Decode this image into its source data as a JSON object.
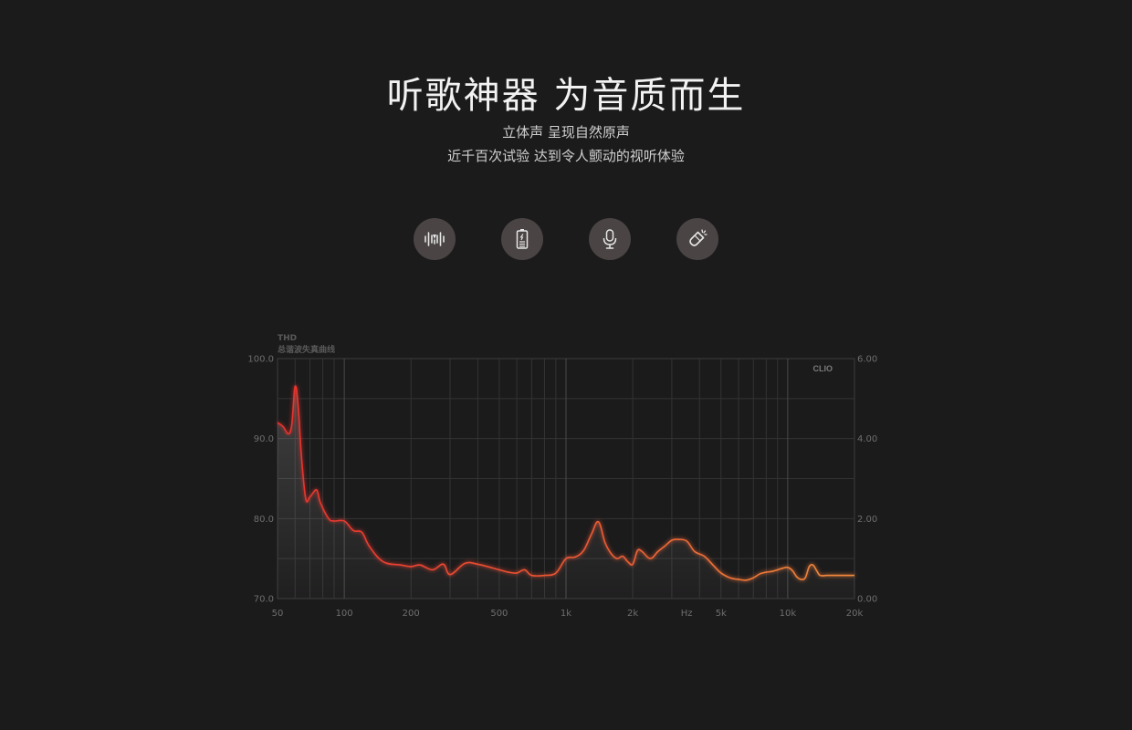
{
  "header": {
    "title": "听歌神器 为音质而生",
    "subtitle_line1": "立体声 呈现自然原声",
    "subtitle_line2": "近千百次试验 达到令人颤动的视听体验"
  },
  "features": [
    {
      "icon": "sound-wave-icon"
    },
    {
      "icon": "battery-icon"
    },
    {
      "icon": "microphone-icon"
    },
    {
      "icon": "magnet-icon"
    }
  ],
  "colors": {
    "background": "#1c1b1c",
    "icon_circle": "#4a4444",
    "curve_start": "#e8322e",
    "curve_end": "#f08a3c",
    "grid": "#3a3a3a"
  },
  "chart_data": {
    "type": "line",
    "title": "THD",
    "subtitle": "总谐波失真曲线",
    "brand": "CLIO",
    "xlabel": "Hz",
    "x_scale": "log",
    "xlim": [
      50,
      20000
    ],
    "ylim": [
      70,
      100
    ],
    "y2lim": [
      0,
      6
    ],
    "y_ticks": [
      "100.0",
      "90.0",
      "80.0",
      "70.0"
    ],
    "y2_ticks": [
      "6.00",
      "4.00",
      "2.00",
      "0.00"
    ],
    "x_tick_values": [
      50,
      100,
      200,
      500,
      1000,
      2000,
      5000,
      10000,
      20000
    ],
    "x_tick_labels": [
      "50",
      "100",
      "200",
      "500",
      "1k",
      "2k",
      "5k",
      "10k",
      "20k"
    ],
    "grid": true,
    "series": [
      {
        "x": [
          50,
          53,
          56,
          58,
          60,
          62,
          64,
          67,
          70,
          75,
          78,
          85,
          90,
          100,
          110,
          120,
          130,
          150,
          180,
          200,
          220,
          250,
          280,
          300,
          350,
          400,
          500,
          550,
          600,
          650,
          700,
          800,
          900,
          1000,
          1100,
          1200,
          1300,
          1400,
          1500,
          1600,
          1700,
          1800,
          1900,
          2000,
          2100,
          2200,
          2400,
          2600,
          2800,
          3000,
          3200,
          3500,
          3800,
          4200,
          4600,
          5000,
          5500,
          6000,
          6500,
          7000,
          7500,
          8000,
          8500,
          9000,
          9500,
          10000,
          10500,
          11000,
          11500,
          12000,
          12500,
          13000,
          13500,
          14000,
          15000,
          16000,
          17000,
          18000,
          20000
        ],
        "y": [
          92.0,
          91.5,
          90.6,
          91.8,
          96.5,
          94.0,
          88.0,
          82.5,
          82.7,
          83.6,
          82.0,
          80.0,
          79.7,
          79.7,
          78.5,
          78.3,
          76.5,
          74.6,
          74.2,
          74.0,
          74.2,
          73.6,
          74.3,
          73.0,
          74.4,
          74.3,
          73.6,
          73.3,
          73.2,
          73.6,
          72.9,
          72.9,
          73.2,
          75.0,
          75.2,
          76.0,
          78.0,
          79.6,
          77.0,
          75.6,
          75.0,
          75.3,
          74.6,
          74.3,
          76.0,
          75.9,
          75.0,
          75.9,
          76.6,
          77.3,
          77.4,
          77.2,
          75.9,
          75.3,
          74.2,
          73.2,
          72.6,
          72.4,
          72.3,
          72.6,
          73.1,
          73.3,
          73.4,
          73.6,
          73.8,
          73.9,
          73.5,
          72.7,
          72.4,
          72.6,
          74.0,
          74.2,
          73.5,
          72.9,
          72.9,
          72.9,
          72.9,
          72.9,
          72.9
        ]
      }
    ]
  }
}
